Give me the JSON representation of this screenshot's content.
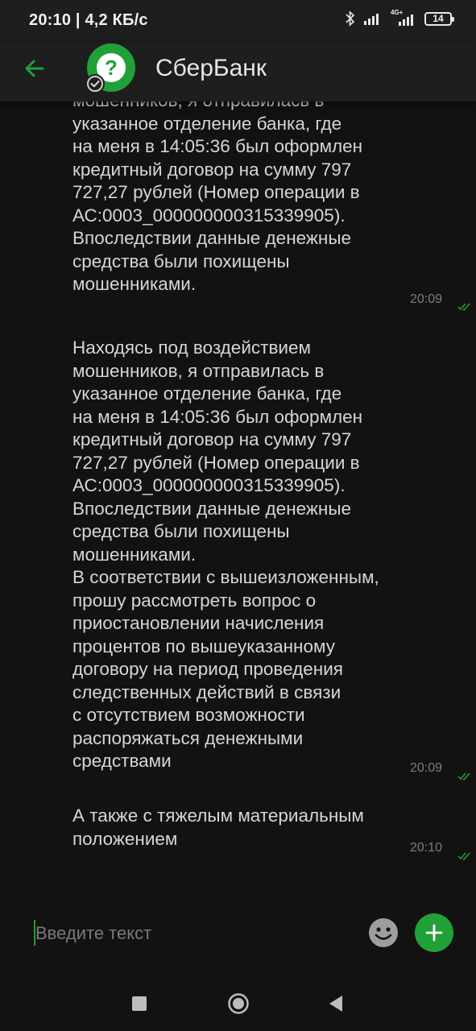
{
  "status_bar": {
    "time_speed": "20:10 | 4,2 КБ/с",
    "network_label": "4G+",
    "battery": "14"
  },
  "header": {
    "title": "СберБанк",
    "avatar_icon": "question-mark-icon",
    "verified_icon": "check-circle-icon"
  },
  "messages": [
    {
      "text": "мошенников, я отправилась в\nуказанное отделение банка, где\nна меня в 14:05:36 был оформлен\nкредитный договор на сумму 797\n727,27 рублей (Номер операции в\nАС:0003_000000000315339905).\nВпоследствии данные денежные\nсредства были похищены\nмошенниками.",
      "time": "20:09"
    },
    {
      "text": "Находясь под воздействием\nмошенников, я отправилась в\nуказанное отделение банка, где\nна меня в 14:05:36 был оформлен\nкредитный договор на сумму 797\n727,27 рублей (Номер операции в\nАС:0003_000000000315339905).\nВпоследствии данные денежные\nсредства были похищены\nмошенниками.\nВ соответствии с вышеизложенным,\nпрошу рассмотреть вопрос о\nприостановлении начисления\nпроцентов по вышеуказанному\nдоговору на период проведения\nследственных действий в связи\nс отсутствием возможности\nраспоряжаться денежными\nсредствами",
      "time": "20:09"
    },
    {
      "text": "А также с тяжелым материальным\nположением",
      "time": "20:10"
    }
  ],
  "composer": {
    "placeholder": "Введите текст"
  },
  "colors": {
    "accent": "#21a038",
    "background": "#121212",
    "bar": "#1e1e1e"
  }
}
